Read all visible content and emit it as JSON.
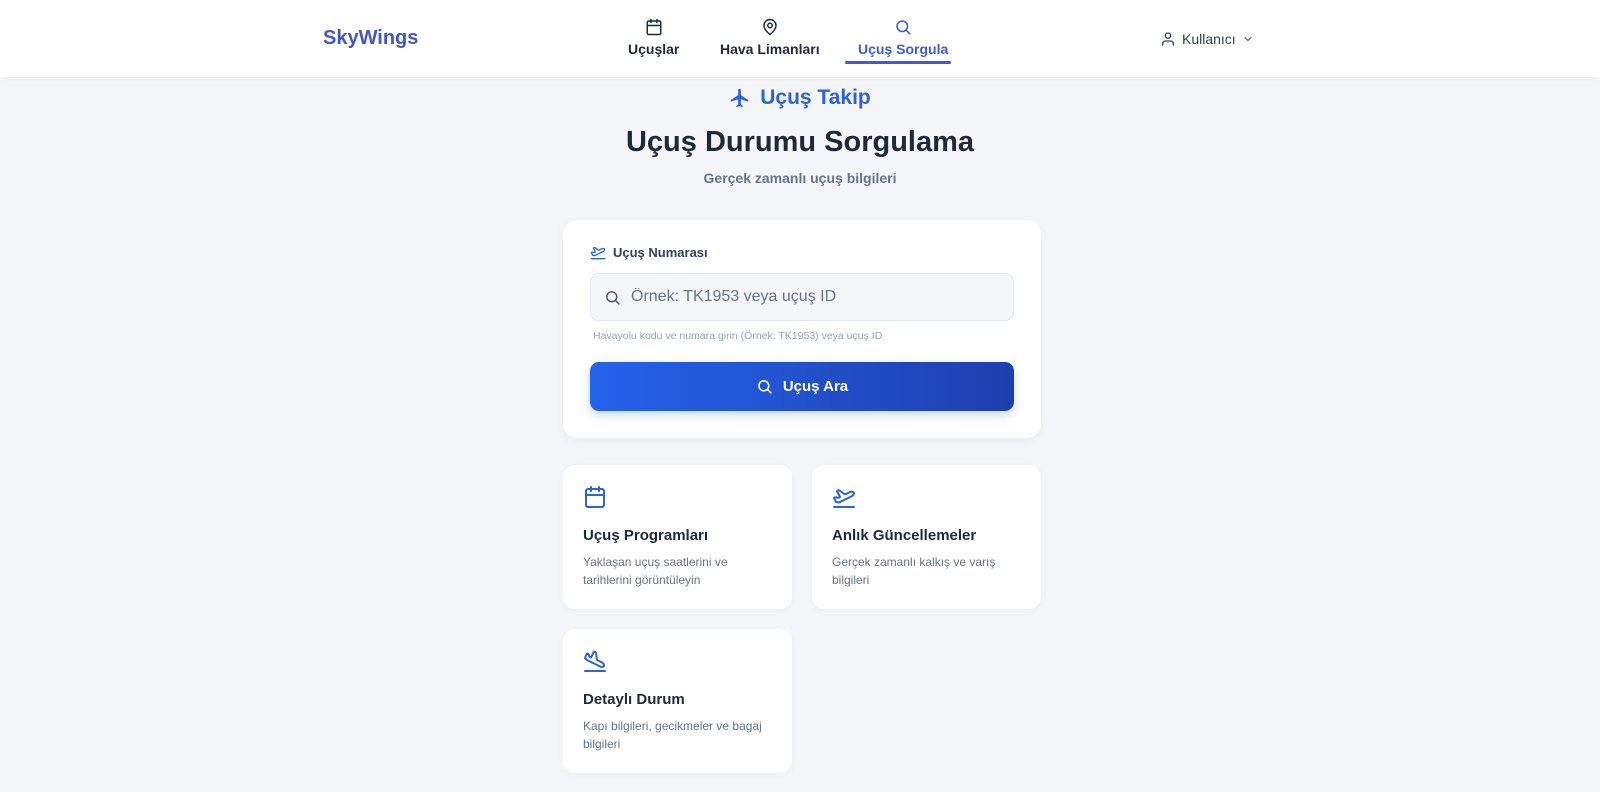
{
  "header": {
    "brand": "SkyWings",
    "nav": [
      {
        "label": "Uçuşlar",
        "icon": "calendar-icon",
        "active": false
      },
      {
        "label": "Hava Limanları",
        "icon": "map-pin-icon",
        "active": false
      },
      {
        "label": "Uçuş Sorgula",
        "icon": "search-icon",
        "active": true
      }
    ],
    "user": {
      "label": "Kullanıcı",
      "icon": "user-icon"
    }
  },
  "hero": {
    "tag": "Uçuş Takip",
    "title": "Uçuş Durumu Sorgulama",
    "subtitle": "Gerçek zamanlı uçuş bilgileri"
  },
  "search": {
    "label": "Uçuş Numarası",
    "placeholder": "Örnek: TK1953 veya uçuş ID",
    "value": "",
    "hint": "Havayolu kodu ve numara girin (Örnek: TK1953) veya uçuş ID",
    "button_label": "Uçuş Ara"
  },
  "features": [
    {
      "icon": "calendar-icon",
      "title": "Uçuş Programları",
      "description": "Yaklaşan uçuş saatlerini ve tarihlerini görüntüleyin"
    },
    {
      "icon": "plane-takeoff-icon",
      "title": "Anlık Güncellemeler",
      "description": "Gerçek zamanlı kalkış ve varış bilgileri"
    },
    {
      "icon": "plane-landing-icon",
      "title": "Detaylı Durum",
      "description": "Kapı bilgileri, gecikmeler ve bagaj bilgileri"
    }
  ],
  "colors": {
    "accent": "#2f62d8",
    "brand": "#4454c9",
    "background": "#f4f6f9",
    "button_gradient_start": "#2563eb",
    "button_gradient_end": "#1e3fae"
  }
}
